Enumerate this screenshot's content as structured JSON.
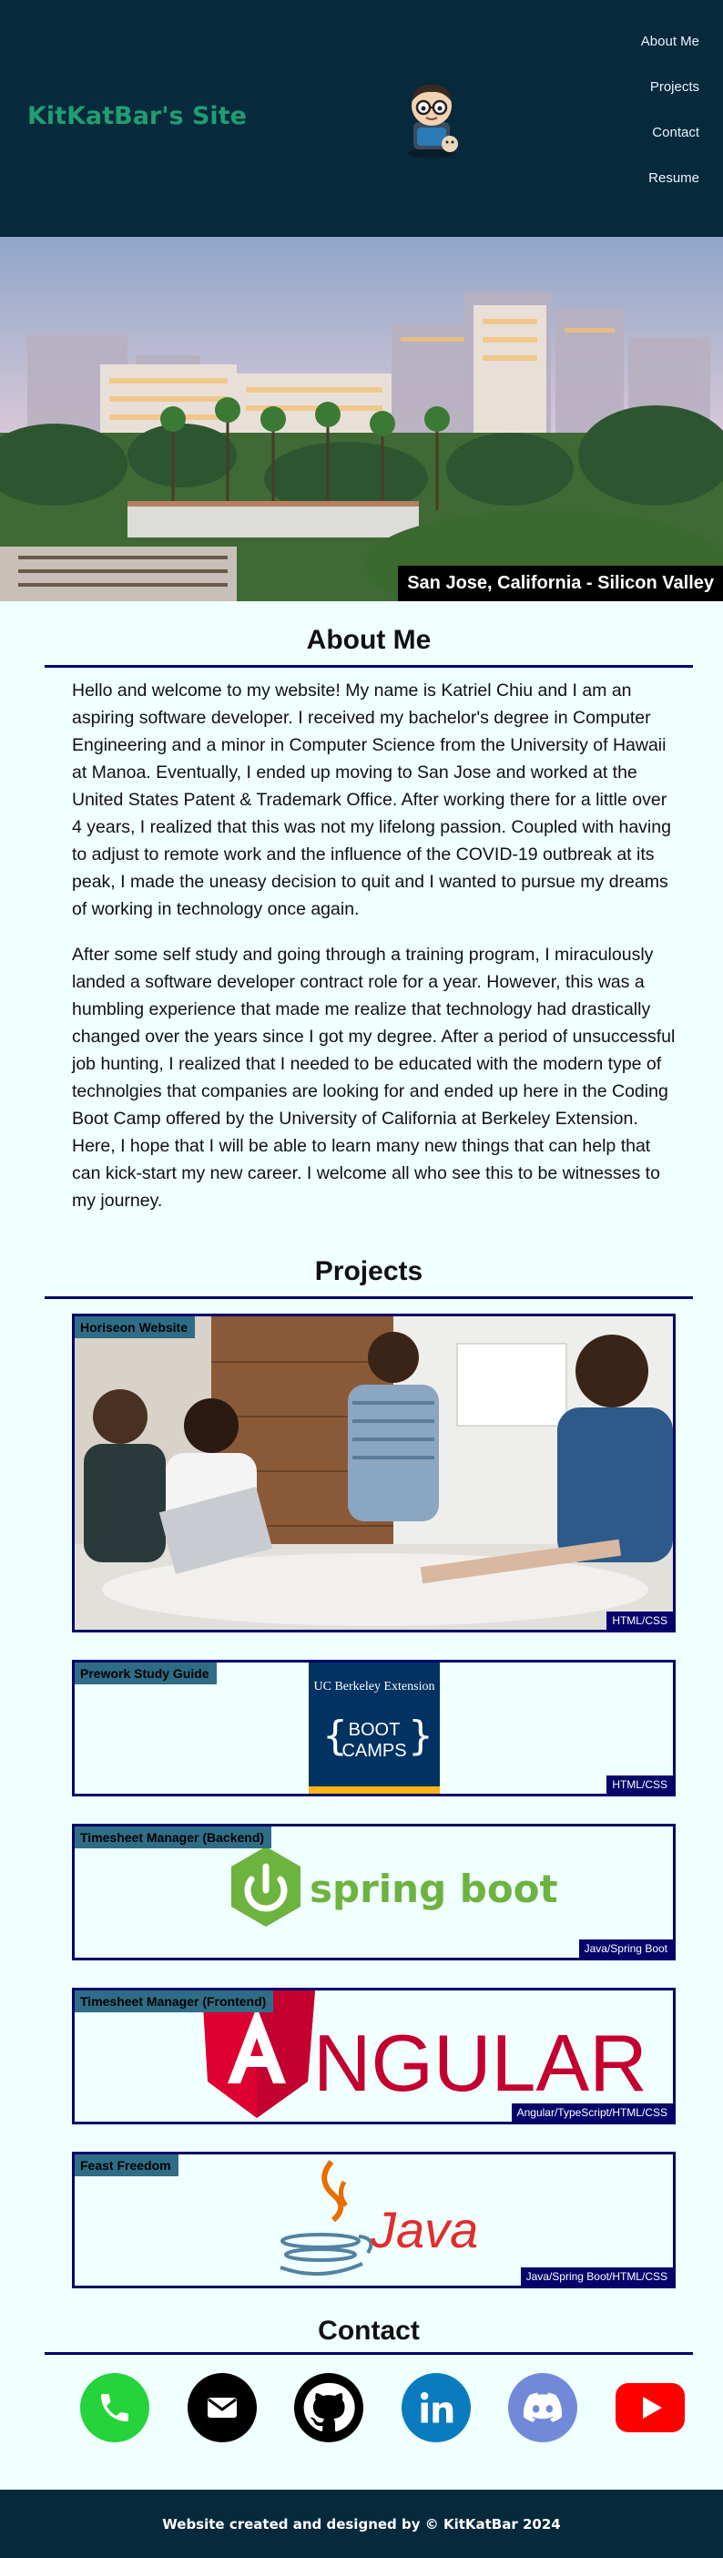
{
  "header": {
    "site_title": "KitKatBar's Site",
    "nav": [
      "About Me",
      "Projects",
      "Contact",
      "Resume"
    ]
  },
  "hero": {
    "caption": "San Jose, California - Silicon Valley"
  },
  "about": {
    "title": "About Me",
    "paragraphs": [
      "Hello and welcome to my website! My name is Katriel Chiu and I am an aspiring software developer. I received my bachelor's degree in Computer Engineering and a minor in Computer Science from the University of Hawaii at Manoa. Eventually, I ended up moving to San Jose and worked at the United States Patent & Trademark Office. After working there for a little over 4 years, I realized that this was not my lifelong passion. Coupled with having to adjust to remote work and the influence of the COVID-19 outbreak at its peak, I made the uneasy decision to quit and I wanted to pursue my dreams of working in technology once again.",
      "After some self study and going through a training program, I miraculously landed a software developer contract role for a year. However, this was a humbling experience that made me realize that technology had drastically changed over the years since I got my degree. After a period of unsuccessful job hunting, I realized that I needed to be educated with the modern type of technolgies that companies are looking for and ended up here in the Coding Boot Camp offered by the University of California at Berkeley Extension. Here, I hope that I will be able to learn many new things that can help that can kick-start my new career. I welcome all who see this to be witnesses to my journey."
    ]
  },
  "projects": {
    "title": "Projects",
    "items": [
      {
        "title": "Horiseon Website",
        "tag": "HTML/CSS"
      },
      {
        "title": "Prework Study Guide",
        "tag": "HTML/CSS",
        "logo_line1": "UC Berkeley Extension",
        "logo_line2": "BOOT",
        "logo_line3": "CAMPS"
      },
      {
        "title": "Timesheet Manager (Backend)",
        "tag": "Java/Spring Boot",
        "logo_text": "spring boot"
      },
      {
        "title": "Timesheet Manager (Frontend)",
        "tag": "Angular/TypeScript/HTML/CSS",
        "logo_text": "NGULAR"
      },
      {
        "title": "Feast Freedom",
        "tag": "Java/Spring Boot/HTML/CSS",
        "logo_text": "Java"
      }
    ]
  },
  "contact": {
    "title": "Contact",
    "icons": [
      "phone-icon",
      "email-icon",
      "github-icon",
      "linkedin-icon",
      "discord-icon",
      "youtube-icon"
    ]
  },
  "footer": {
    "text": "Website created and designed by © KitKatBar 2024"
  },
  "colors": {
    "header_bg": "#06293b",
    "accent_green": "#1f9e72",
    "border_navy": "#04046b",
    "page_bg": "#f0ffff"
  }
}
